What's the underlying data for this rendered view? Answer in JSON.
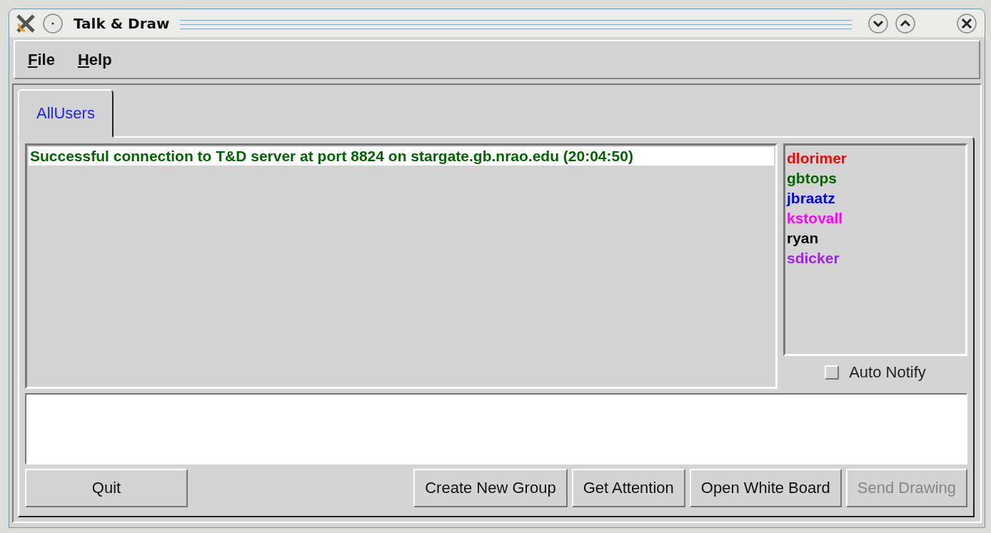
{
  "window": {
    "title": "Talk & Draw"
  },
  "menu": [
    {
      "label": "File",
      "underline_first": true
    },
    {
      "label": "Help",
      "underline_first": true
    }
  ],
  "tabs": [
    {
      "label": "AllUsers",
      "selected": true
    }
  ],
  "messages": [
    {
      "text": "Successful connection to T&D server at port 8824 on stargate.gb.nrao.edu (20:04:50)",
      "color": "#006400",
      "selected": true
    }
  ],
  "users": [
    {
      "name": "dlorimer",
      "color": "#ff0000"
    },
    {
      "name": "gbtops",
      "color": "#006400"
    },
    {
      "name": "jbraatz",
      "color": "#0000ff"
    },
    {
      "name": "kstovall",
      "color": "#ff00ff"
    },
    {
      "name": "ryan",
      "color": "#000000"
    },
    {
      "name": "sdicker",
      "color": "#a020f0"
    }
  ],
  "auto_notify": {
    "label": "Auto Notify",
    "checked": false
  },
  "buttons": [
    {
      "label": "Quit",
      "disabled": false,
      "kind": "left"
    },
    {
      "label": "Create New Group",
      "disabled": false,
      "kind": "right"
    },
    {
      "label": "Get Attention",
      "disabled": false,
      "kind": "right"
    },
    {
      "label": "Open White Board",
      "disabled": false,
      "kind": "right"
    },
    {
      "label": "Send Drawing",
      "disabled": true,
      "kind": "right"
    }
  ]
}
